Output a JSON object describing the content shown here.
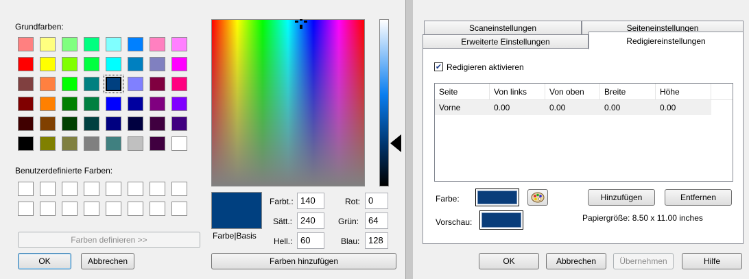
{
  "color_dialog": {
    "basic_colors_label": "Grundfarben:",
    "basic_colors": [
      [
        "#ff8080",
        "#ffff80",
        "#80ff80",
        "#00ff80",
        "#80ffff",
        "#0080ff",
        "#ff80c0",
        "#ff80ff"
      ],
      [
        "#ff0000",
        "#ffff00",
        "#80ff00",
        "#00ff40",
        "#00ffff",
        "#0080c0",
        "#8080c0",
        "#ff00ff"
      ],
      [
        "#804040",
        "#ff8040",
        "#00ff00",
        "#008080",
        "#004080",
        "#8080ff",
        "#800040",
        "#ff0080"
      ],
      [
        "#800000",
        "#ff8000",
        "#008000",
        "#008040",
        "#0000ff",
        "#0000a0",
        "#800080",
        "#8000ff"
      ],
      [
        "#400000",
        "#804000",
        "#004000",
        "#004040",
        "#000080",
        "#000040",
        "#400040",
        "#400080"
      ],
      [
        "#000000",
        "#808000",
        "#808040",
        "#808080",
        "#408080",
        "#c0c0c0",
        "#400040",
        "#ffffff"
      ]
    ],
    "custom_colors_label": "Benutzerdefinierte Farben:",
    "define_button": "Farben definieren >>",
    "ok_button": "OK",
    "cancel_button": "Abbrechen",
    "preview_label": "Farbe|Basis",
    "preview_color": "#004080",
    "hue_label": "Farbt.:",
    "hue_value": "140",
    "sat_label": "Sätt.:",
    "sat_value": "240",
    "lum_label": "Hell.:",
    "lum_value": "60",
    "red_label": "Rot:",
    "red_value": "0",
    "green_label": "Grün:",
    "green_value": "64",
    "blue_label": "Blau:",
    "blue_value": "128",
    "add_button": "Farben hinzufügen"
  },
  "scan_dialog": {
    "tabs": {
      "scan": "Scaneinstellungen",
      "page": "Seiteneinstellungen",
      "advanced": "Erweiterte Einstellungen",
      "redact": "Redigiereinstellungen"
    },
    "enable_label": "Redigieren aktivieren",
    "enable_checked": true,
    "columns": [
      "Seite",
      "Von links",
      "Von oben",
      "Breite",
      "Höhe"
    ],
    "rows": [
      [
        "Vorne",
        "0.00",
        "0.00",
        "0.00",
        "0.00"
      ]
    ],
    "color_label": "Farbe:",
    "color_value": "#0a3d7a",
    "palette_icon": "palette-icon",
    "add_button": "Hinzufügen",
    "remove_button": "Entfernen",
    "preview_label": "Vorschau:",
    "paper_size": "Papiergröße:  8.50 x 11.00 inches",
    "ok_button": "OK",
    "cancel_button": "Abbrechen",
    "apply_button": "Übernehmen",
    "help_button": "Hilfe"
  }
}
